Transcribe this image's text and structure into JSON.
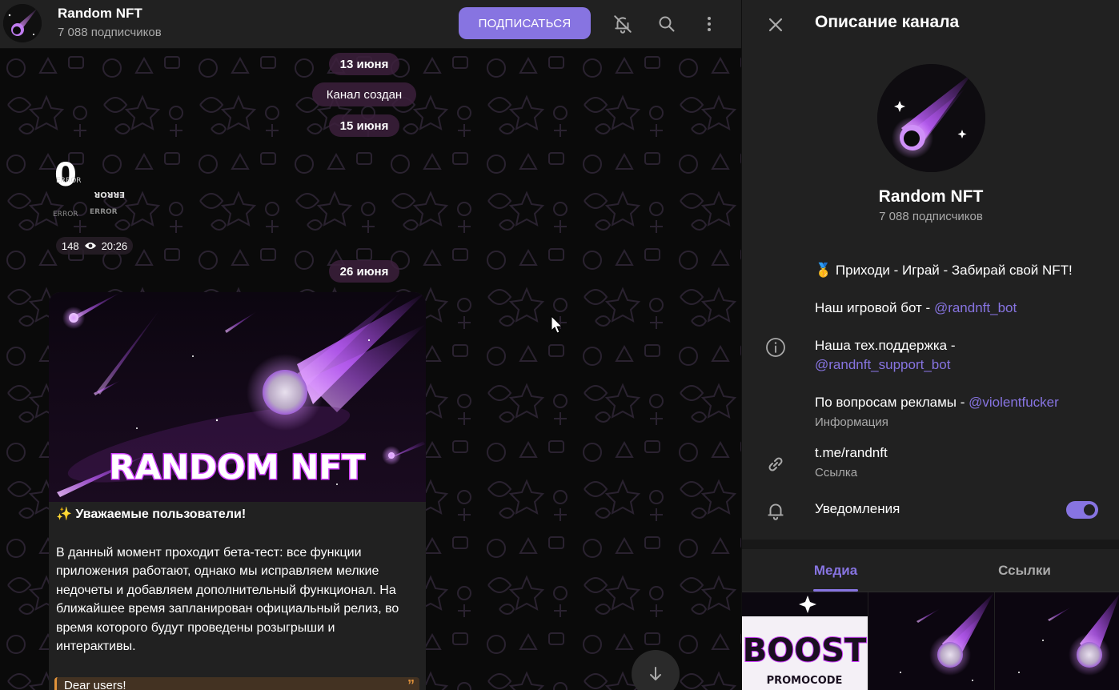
{
  "colors": {
    "accent": "#8774e1",
    "quote_accent": "#e1923a",
    "panel_bg": "#212121",
    "chat_bg": "#0a0a0a"
  },
  "header": {
    "title": "Random NFT",
    "subtitle": "7 088 подписчиков",
    "subscribe_label": "ПОДПИСАТЬСЯ",
    "icons": [
      "bell-off-icon",
      "search-icon",
      "more-vertical-icon"
    ]
  },
  "chat": {
    "dates": {
      "d1": "13 июня",
      "d2": "15 июня",
      "d3": "26 июня"
    },
    "service": "Канал создан",
    "sticker_message": {
      "sticker_text": {
        "big": "0",
        "words": [
          "ERROR",
          "ERROR",
          "ERROR",
          "ERROR"
        ]
      },
      "views": "148",
      "time": "20:26"
    },
    "post": {
      "image_title": "RANDOM NFT",
      "lead": "✨ Уважаемые пользователи!",
      "body": "В данный момент проходит бета-тест: все функции приложения работают, однако мы исправляем мелкие недочеты и добавляем дополнительный функционал. На ближайшее время запланирован официальный релиз, во время которого будут проведены розыгрыши и интерактивы.",
      "quote": "Dear users!"
    }
  },
  "panel": {
    "title": "Описание канала",
    "channel_name": "Random NFT",
    "subscribers": "7 088 подписчиков",
    "description": {
      "line1": "🥇 Приходи - Играй - Забирай свой NFT!",
      "line2_prefix": "Наш игровой бот - ",
      "line2_link": "@randnft_bot",
      "line3_prefix": "Наша тех.поддержка - ",
      "line3_link": "@randnft_support_bot",
      "line4_prefix": "По вопросам рекламы - ",
      "line4_link": "@violentfucker"
    },
    "description_label": "Информация",
    "link_value": "t.me/randnft",
    "link_label": "Ссылка",
    "notifications_label": "Уведомления",
    "notifications_on": true,
    "tabs": [
      "Медиа",
      "Ссылки"
    ],
    "active_tab": "Медиа",
    "media": [
      {
        "kind": "promo",
        "title": "BOOST",
        "caption": "PROMOCODE"
      },
      {
        "kind": "meteor"
      },
      {
        "kind": "meteor"
      }
    ]
  }
}
